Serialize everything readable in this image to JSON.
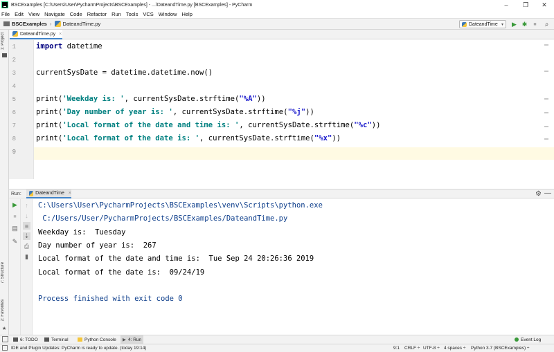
{
  "window": {
    "title": "BSCExamples [C:\\Users\\User\\PycharmProjects\\BSCExamples] - ...\\DateandTime.py [BSCExamples] - PyCharm",
    "minimize": "–",
    "maximize": "❐",
    "close": "✕"
  },
  "menu": [
    "File",
    "Edit",
    "View",
    "Navigate",
    "Code",
    "Refactor",
    "Run",
    "Tools",
    "VCS",
    "Window",
    "Help"
  ],
  "breadcrumbs": {
    "project": "BSCExamples",
    "file": "DateandTime.py",
    "separator": "›"
  },
  "run_config": {
    "label": "DateandTime",
    "arrow": "▾"
  },
  "toolbar_icons": {
    "run": "▶",
    "debug": "✱",
    "stop": "■",
    "search": "⌕"
  },
  "side_tabs": {
    "project": "1: Project",
    "structure": "7: Structure",
    "favorites": "2: Favorites"
  },
  "editor_tab": {
    "label": "DateandTime.py",
    "close": "×"
  },
  "line_numbers": [
    "1",
    "2",
    "3",
    "4",
    "5",
    "6",
    "7",
    "8",
    "9"
  ],
  "code_lines": [
    {
      "parts": [
        {
          "t": "import",
          "c": "kw"
        },
        {
          "t": " datetime",
          "c": ""
        }
      ]
    },
    {
      "parts": []
    },
    {
      "parts": [
        {
          "t": "currentSysDate = datetime.datetime.now()",
          "c": ""
        }
      ]
    },
    {
      "parts": []
    },
    {
      "parts": [
        {
          "t": "print(",
          "c": ""
        },
        {
          "t": "'Weekday is: '",
          "c": "str"
        },
        {
          "t": ", currentSysDate.strftime(",
          "c": ""
        },
        {
          "t": "\"%A\"",
          "c": "fmt"
        },
        {
          "t": "))",
          "c": ""
        }
      ]
    },
    {
      "parts": [
        {
          "t": "print(",
          "c": ""
        },
        {
          "t": "'Day number of year is: '",
          "c": "str"
        },
        {
          "t": ", currentSysDate.strftime(",
          "c": ""
        },
        {
          "t": "\"%j\"",
          "c": "fmt"
        },
        {
          "t": "))",
          "c": ""
        }
      ]
    },
    {
      "parts": [
        {
          "t": "print(",
          "c": ""
        },
        {
          "t": "'Local format of the date and time is: '",
          "c": "str"
        },
        {
          "t": ", currentSysDate.strftime(",
          "c": ""
        },
        {
          "t": "\"%c\"",
          "c": "fmt"
        },
        {
          "t": "))",
          "c": ""
        }
      ]
    },
    {
      "parts": [
        {
          "t": "print(",
          "c": ""
        },
        {
          "t": "'Local format of the date is: '",
          "c": "str"
        },
        {
          "t": ", currentSysDate.strftime(",
          "c": ""
        },
        {
          "t": "\"%x\"",
          "c": "fmt"
        },
        {
          "t": "))",
          "c": ""
        }
      ]
    },
    {
      "parts": []
    }
  ],
  "run_panel": {
    "label": "Run:",
    "tab": "DateandTime",
    "tab_close": "×",
    "settings": "⚙",
    "hide": "—"
  },
  "console_lines": [
    {
      "text": "C:\\Users\\User\\PycharmProjects\\BSCExamples\\venv\\Scripts\\python.exe",
      "c": "console-path"
    },
    {
      "text": " C:/Users/User/PycharmProjects/BSCExamples/DateandTime.py",
      "c": "console-path"
    },
    {
      "text": "Weekday is:  Tuesday",
      "c": ""
    },
    {
      "text": "Day number of year is:  267",
      "c": ""
    },
    {
      "text": "Local format of the date and time is:  Tue Sep 24 20:26:36 2019",
      "c": ""
    },
    {
      "text": "Local format of the date is:  09/24/19",
      "c": ""
    },
    {
      "text": "",
      "c": ""
    },
    {
      "text": "Process finished with exit code 0",
      "c": "console-exit"
    }
  ],
  "bottom_tools": {
    "todo": "6: TODO",
    "terminal": "Terminal",
    "python_console": "Python Console",
    "run": "4: Run",
    "event_log": "Event Log"
  },
  "status": {
    "message": "IDE and Plugin Updates: PyCharm is ready to update. (today 19:14)",
    "position": "9:1",
    "line_sep": "CRLF ÷",
    "encoding": "UTF-8 ÷",
    "indent": "4 spaces ÷",
    "interpreter": "Python 3.7 (BSCExamples) ÷"
  },
  "colors": {
    "keyword": "#000080",
    "string": "#008080",
    "format_spec": "#1a1acc",
    "console_path": "#0b3c8a",
    "current_line": "#fffae3",
    "run_green": "#3a9a3a"
  }
}
